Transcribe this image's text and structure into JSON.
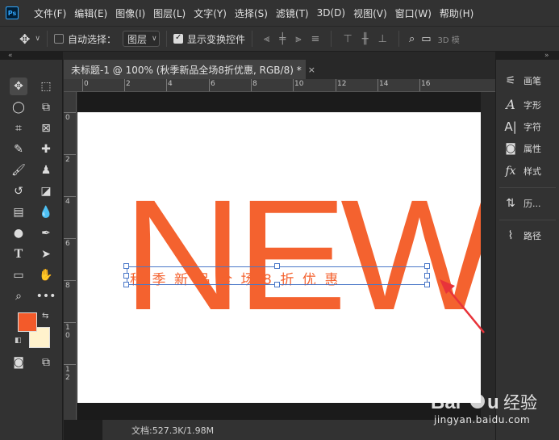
{
  "app": {
    "logo": "Ps"
  },
  "menu": [
    "文件(F)",
    "编辑(E)",
    "图像(I)",
    "图层(L)",
    "文字(Y)",
    "选择(S)",
    "滤镜(T)",
    "3D(D)",
    "视图(V)",
    "窗口(W)",
    "帮助(H)"
  ],
  "options": {
    "auto_select_label": "自动选择：",
    "layer_dropdown": "图层",
    "show_transform_label": "显示变换控件",
    "mode_3d": "3D 模"
  },
  "document": {
    "tab_title": "未标题-1 @ 100% (秋季新品全场8折优惠, RGB/8) *",
    "close": "×",
    "main_text": "NEW",
    "sub_text": "秋季新品全场8折优惠"
  },
  "rulers": {
    "top": [
      "0",
      "2",
      "4",
      "6",
      "8",
      "10",
      "12",
      "14",
      "16"
    ],
    "left": [
      "0",
      "2",
      "4",
      "6",
      "8",
      "1 0",
      "1 2"
    ]
  },
  "status": {
    "doc_info": "文档:527.3K/1.98M"
  },
  "colors": {
    "foreground": "#f35a2a",
    "background": "#fff2cc",
    "text_orange": "#f4622f",
    "annotation_red": "#e8333a"
  },
  "right_panel": [
    {
      "label": "画笔",
      "icon": "brush-settings-icon"
    },
    {
      "label": "字形",
      "icon": "glyphs-icon"
    },
    {
      "label": "字符",
      "icon": "character-icon"
    },
    {
      "label": "属性",
      "icon": "properties-icon"
    },
    {
      "label": "样式",
      "icon": "styles-icon"
    },
    {
      "label": "历...",
      "icon": "history-icon"
    },
    {
      "label": "路径",
      "icon": "paths-icon"
    }
  ],
  "watermark": {
    "url": "jingyan.baidu.com"
  }
}
